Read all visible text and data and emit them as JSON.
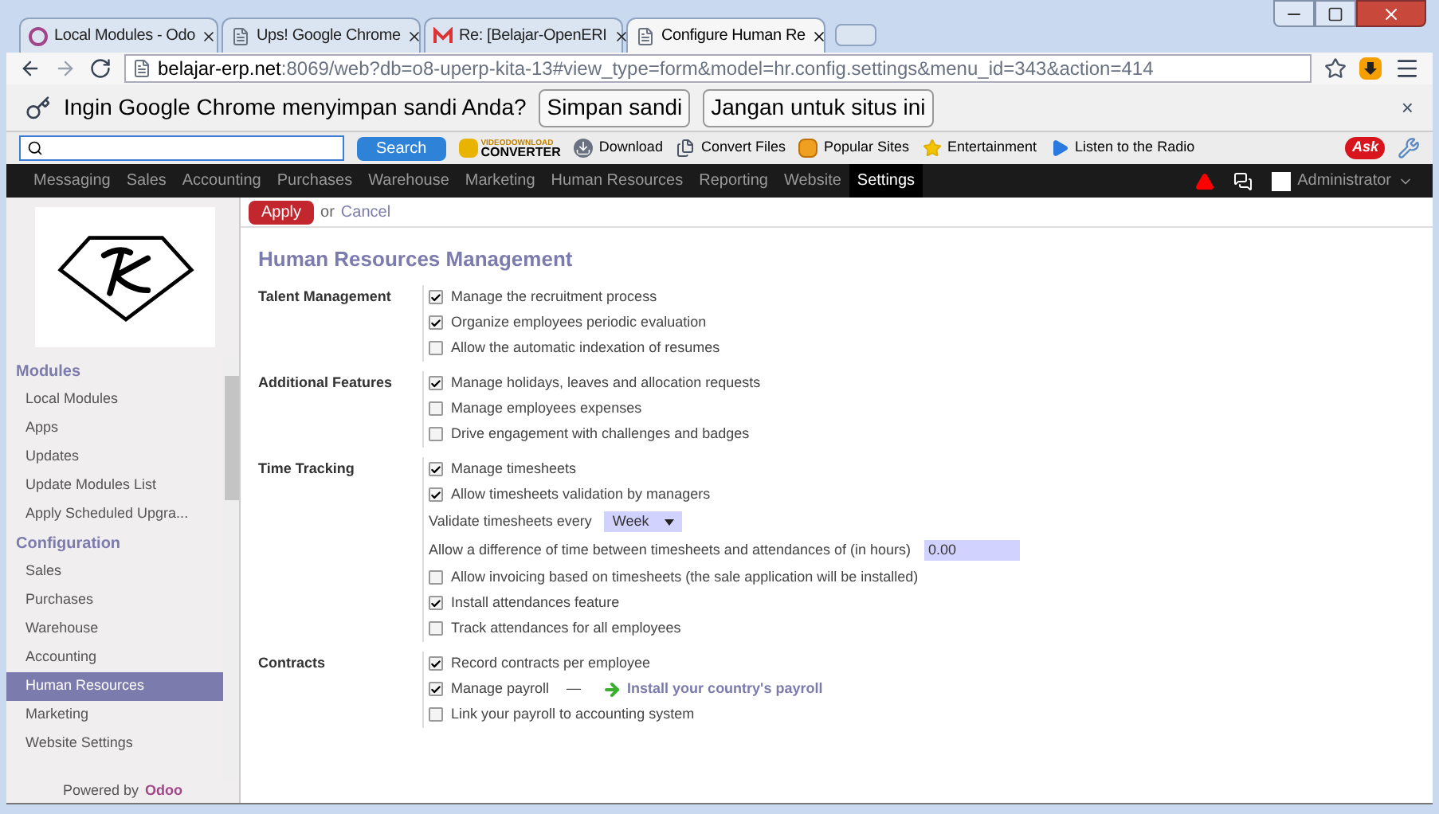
{
  "browser_tabs": [
    {
      "title": "Local Modules - Odo",
      "kind": "odoo",
      "selected": false
    },
    {
      "title": "Ups! Google Chrome",
      "kind": "page",
      "selected": false
    },
    {
      "title": "Re: [Belajar-OpenERI",
      "kind": "gmail",
      "selected": false
    },
    {
      "title": "Configure Human Re",
      "kind": "page",
      "selected": true
    }
  ],
  "address": {
    "host": "belajar-erp.net",
    "path": ":8069/web?db=o8-uperp-kita-13#view_type=form&model=hr.config.settings&menu_id=343&action=414"
  },
  "password_bar": {
    "prompt": "Ingin Google Chrome menyimpan sandi Anda?",
    "buttons": [
      "Simpan sandi",
      "Jangan untuk situs ini"
    ],
    "close": "×"
  },
  "toolbar": {
    "search_button": "Search",
    "logo_top": "VIDEODOWNLOAD",
    "logo_bottom": "CONVERTER",
    "items": [
      {
        "label": "Download",
        "kind": "download"
      },
      {
        "label": "Convert Files",
        "kind": "convert"
      },
      {
        "label": "Popular Sites",
        "kind": "sites"
      },
      {
        "label": "Entertainment",
        "kind": "star"
      },
      {
        "label": "Listen to the Radio",
        "kind": "play"
      }
    ],
    "ask": "Ask"
  },
  "nav": {
    "items": [
      {
        "label": "Messaging",
        "selected": false
      },
      {
        "label": "Sales",
        "selected": false
      },
      {
        "label": "Accounting",
        "selected": false
      },
      {
        "label": "Purchases",
        "selected": false
      },
      {
        "label": "Warehouse",
        "selected": false
      },
      {
        "label": "Marketing",
        "selected": false
      },
      {
        "label": "Human Resources",
        "selected": false
      },
      {
        "label": "Reporting",
        "selected": false
      },
      {
        "label": "Website",
        "selected": false
      },
      {
        "label": "Settings",
        "selected": true
      }
    ],
    "user": "Administrator"
  },
  "actions": {
    "apply": "Apply",
    "or": "or",
    "cancel": "Cancel"
  },
  "sidebar": {
    "sections": [
      {
        "title": "Modules",
        "items": [
          {
            "label": "Local Modules",
            "selected": false
          },
          {
            "label": "Apps",
            "selected": false
          },
          {
            "label": "Updates",
            "selected": false
          },
          {
            "label": "Update Modules List",
            "selected": false
          },
          {
            "label": "Apply Scheduled Upgra...",
            "selected": false
          }
        ]
      },
      {
        "title": "Configuration",
        "items": [
          {
            "label": "Sales",
            "selected": false
          },
          {
            "label": "Purchases",
            "selected": false
          },
          {
            "label": "Warehouse",
            "selected": false
          },
          {
            "label": "Accounting",
            "selected": false
          },
          {
            "label": "Human Resources",
            "selected": true
          },
          {
            "label": "Marketing",
            "selected": false
          },
          {
            "label": "Website Settings",
            "selected": false
          }
        ]
      }
    ],
    "powered_by": "Powered by",
    "brand": "Odoo"
  },
  "form": {
    "title": "Human Resources Management",
    "groups": [
      {
        "label": "Talent Management",
        "rows": [
          {
            "kind": "checkbox",
            "label": "Manage the recruitment process",
            "checked": true
          },
          {
            "kind": "checkbox",
            "label": "Organize employees periodic evaluation",
            "checked": true
          },
          {
            "kind": "checkbox",
            "label": "Allow the automatic indexation of resumes",
            "checked": false
          }
        ]
      },
      {
        "label": "Additional Features",
        "rows": [
          {
            "kind": "checkbox",
            "label": "Manage holidays, leaves and allocation requests",
            "checked": true
          },
          {
            "kind": "checkbox",
            "label": "Manage employees expenses",
            "checked": false
          },
          {
            "kind": "checkbox",
            "label": "Drive engagement with challenges and badges",
            "checked": false
          }
        ]
      },
      {
        "label": "Time Tracking",
        "rows": [
          {
            "kind": "checkbox",
            "label": "Manage timesheets",
            "checked": true
          },
          {
            "kind": "checkbox",
            "label": "Allow timesheets validation by managers",
            "checked": true
          },
          {
            "kind": "select",
            "label": "Validate timesheets every",
            "value": "Week"
          },
          {
            "kind": "input",
            "label": "Allow a difference of time between timesheets and attendances of (in hours)",
            "value": "0.00"
          },
          {
            "kind": "checkbox",
            "label": "Allow invoicing based on timesheets (the sale application will be installed)",
            "checked": false
          },
          {
            "kind": "checkbox",
            "label": "Install attendances feature",
            "checked": true
          },
          {
            "kind": "checkbox",
            "label": "Track attendances for all employees",
            "checked": false
          }
        ]
      },
      {
        "label": "Contracts",
        "rows": [
          {
            "kind": "checkbox",
            "label": "Record contracts per employee",
            "checked": true
          },
          {
            "kind": "checkbox",
            "label": "Manage payroll",
            "checked": true,
            "dash": "—",
            "link": "Install your country's payroll"
          },
          {
            "kind": "checkbox",
            "label": "Link your payroll to accounting system",
            "checked": false
          }
        ]
      }
    ]
  }
}
